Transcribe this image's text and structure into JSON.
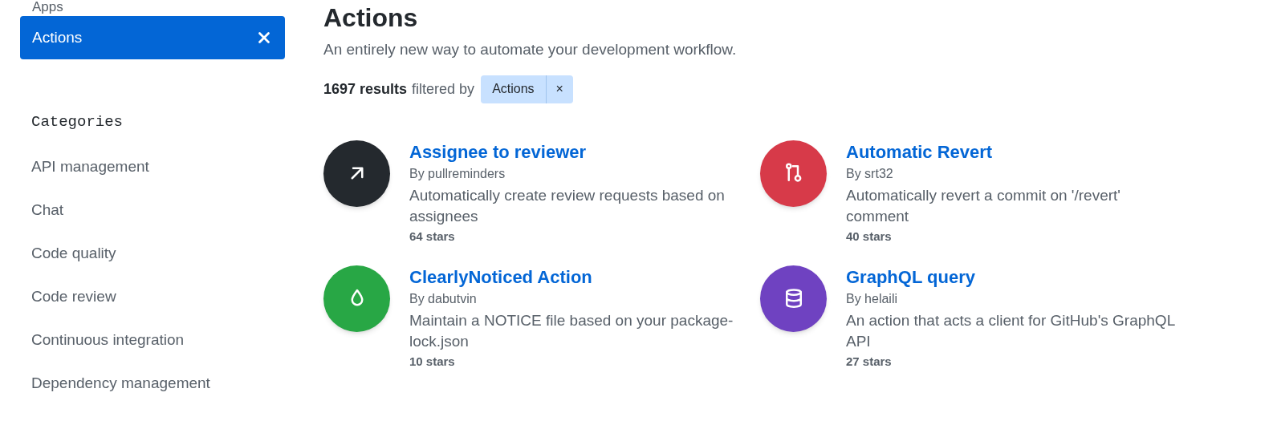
{
  "sidebar": {
    "types": [
      {
        "label": "Apps",
        "selected": false
      },
      {
        "label": "Actions",
        "selected": true
      }
    ],
    "categories_title": "Categories",
    "categories": [
      {
        "label": "API management",
        "selected": false
      },
      {
        "label": "Chat",
        "selected": false
      },
      {
        "label": "Code quality",
        "selected": false
      },
      {
        "label": "Code review",
        "selected": false
      },
      {
        "label": "Continuous integration",
        "selected": false
      },
      {
        "label": "Dependency management",
        "selected": false
      }
    ]
  },
  "main": {
    "title": "Actions",
    "subtitle": "An entirely new way to automate your development workflow.",
    "results_count": "1697 results",
    "results_text": "filtered by",
    "filter_chip": {
      "label": "Actions",
      "remove": "×"
    },
    "cards": [
      {
        "title": "Assignee to reviewer",
        "author": "By pullreminders",
        "description": "Automatically create review requests based on assignees",
        "stars_text": "64 stars",
        "color": "#24292e"
      },
      {
        "title": "Automatic Revert",
        "author": "By srt32",
        "description": "Automatically revert a commit on '/revert' comment",
        "stars_text": "40 stars",
        "color": "#d73a49"
      },
      {
        "title": "ClearlyNoticed Action",
        "author": "By dabutvin",
        "description": "Maintain a NOTICE file based on your package-lock.json",
        "stars_text": "10 stars",
        "color": "#28a745"
      },
      {
        "title": "GraphQL query",
        "author": "By helaili",
        "description": "An action that acts a client for GitHub's GraphQL API",
        "stars_text": "27 stars",
        "color": "#6f42c1"
      }
    ]
  }
}
